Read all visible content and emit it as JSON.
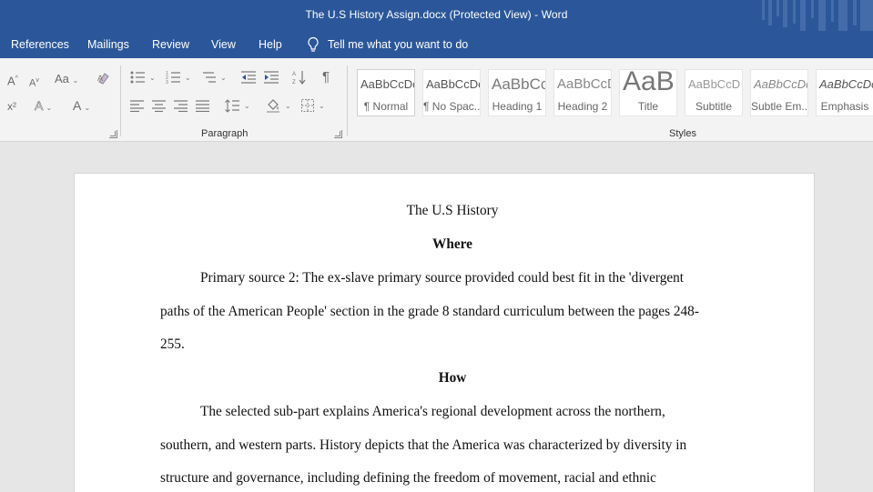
{
  "window": {
    "title": "The U.S History Assign.docx (Protected View)  -  Word"
  },
  "ribbon_tabs": {
    "references": "References",
    "mailings": "Mailings",
    "review": "Review",
    "view": "View",
    "help": "Help",
    "tell_me": "Tell me what you want to do"
  },
  "ribbon": {
    "font_group": {
      "grow": "A",
      "shrink": "A",
      "change_case": "Aa",
      "superscript": "x²",
      "effects": "A",
      "font_color": "A"
    },
    "paragraph_group": {
      "label": "Paragraph",
      "show_marks": "¶"
    },
    "styles_group": {
      "label": "Styles",
      "items": [
        {
          "sample": "AaBbCcDc",
          "name": "¶ Normal"
        },
        {
          "sample": "AaBbCcDc",
          "name": "¶ No Spac..."
        },
        {
          "sample": "AaBbCc",
          "name": "Heading 1"
        },
        {
          "sample": "AaBbCcD",
          "name": "Heading 2"
        },
        {
          "sample": "AaB",
          "name": "Title"
        },
        {
          "sample": "AaBbCcD",
          "name": "Subtitle"
        },
        {
          "sample": "AaBbCcDc",
          "name": "Subtle Em..."
        },
        {
          "sample": "AaBbCcDc",
          "name": "Emphasis"
        }
      ]
    }
  },
  "document": {
    "title": "The U.S History",
    "heading_where": "Where",
    "para1": [
      "Primary source 2: The ex-slave primary source provided could best fit in the 'divergent",
      "paths of the American People' section in the grade 8 standard curriculum between the pages 248-",
      "255."
    ],
    "heading_how": "How",
    "para2": [
      "The selected sub-part explains America's regional development across the northern,",
      "southern, and western parts. History depicts that the America was characterized by diversity in",
      "structure and governance, including defining the freedom of movement, racial and ethnic"
    ]
  },
  "colors": {
    "brand_blue": "#2b579a",
    "ribbon_bg": "#f3f3f3",
    "canvas_bg": "#e6e6e6"
  }
}
